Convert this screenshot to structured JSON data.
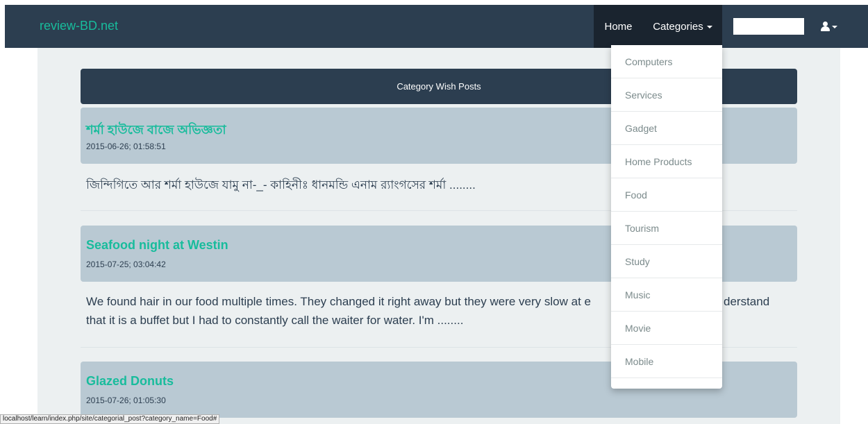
{
  "navbar": {
    "brand": "review-BD.net",
    "home": "Home",
    "categories": "Categories",
    "search_value": ""
  },
  "header": {
    "title": "Category Wish Posts"
  },
  "posts": [
    {
      "title": "শর্মা হাউজে বাজে অভিজ্ঞতা",
      "date": "2015-06-26; 01:58:51",
      "excerpt": "জিন্দিগিতে আর শর্মা হাউজে যামু না-_- কাহিনীঃ ধানমন্ডি এনাম র‍্যাংগসের শর্মা ........"
    },
    {
      "title": "Seafood night at Westin",
      "date": "2015-07-25; 03:04:42",
      "excerpt_line1": "We found hair in our food multiple times. They changed it right away but they were very slow at e",
      "excerpt_line1_tail": "derstand",
      "excerpt_line2": "that it is a buffet but I had to constantly call the waiter for water. I'm ........"
    },
    {
      "title": "Glazed Donuts",
      "date": "2015-07-26; 01:05:30"
    }
  ],
  "dropdown": {
    "items": [
      "Computers",
      "Services",
      "Gadget",
      "Home Products",
      "Food",
      "Tourism",
      "Study",
      "Music",
      "Movie",
      "Mobile"
    ]
  },
  "status_url": "localhost/learn/index.php/site/categorial_post?category_name=Food#",
  "colors": {
    "navbar": "#2c3e50",
    "accent": "#18bc9c",
    "post_head": "#b9c9d3",
    "content_bg": "#ecf0f1"
  },
  "icons": {
    "user": "user-icon",
    "caret": "caret-down-icon"
  }
}
